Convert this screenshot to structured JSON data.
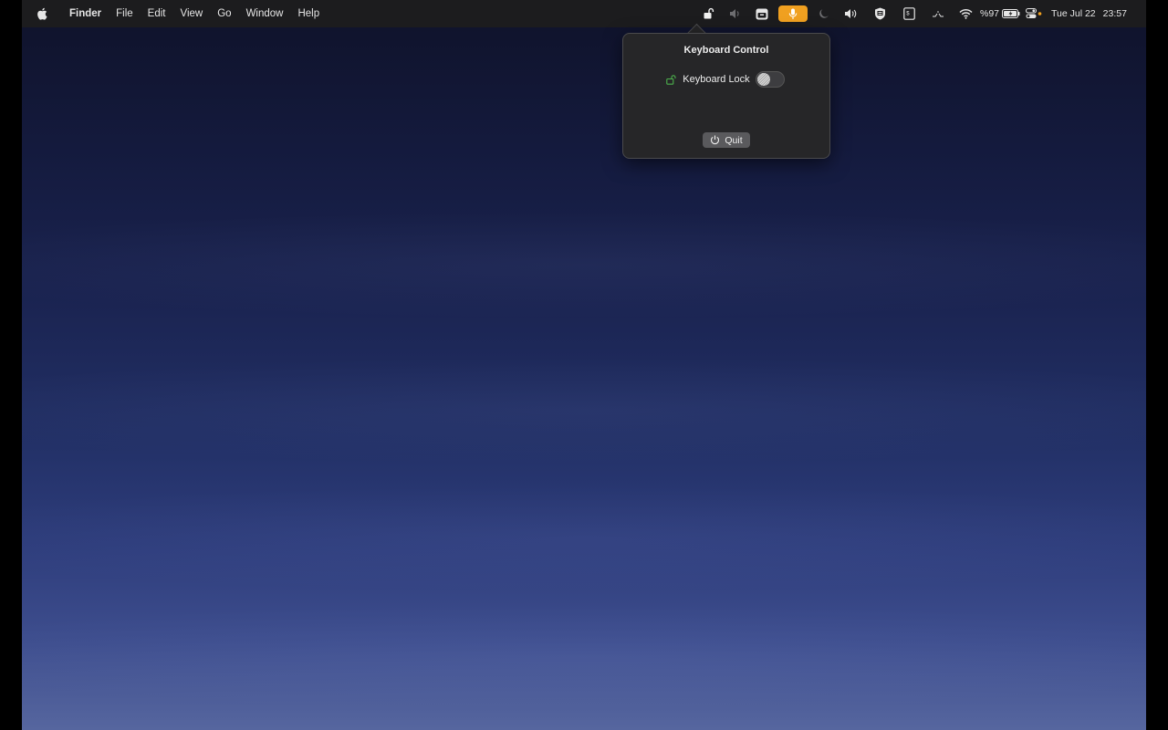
{
  "menubar": {
    "apple_icon": "apple-logo-icon",
    "app_name": "Finder",
    "menus": [
      "File",
      "Edit",
      "View",
      "Go",
      "Window",
      "Help"
    ],
    "status_icons": [
      "keyboard-lock-icon",
      "volume-muted-icon",
      "menu-app-icon",
      "microphone-icon",
      "moon-icon",
      "volume-icon",
      "shield-icon",
      "document-icon",
      "network-monitor-icon",
      "wifi-icon",
      "battery-icon",
      "control-center-icon"
    ],
    "battery_percent": "%97",
    "date": "Tue Jul 22",
    "time": "23:57",
    "accent_mic": "#f0a020"
  },
  "popup": {
    "title": "Keyboard Control",
    "lock_label": "Keyboard Lock",
    "lock_icon": "unlocked-padlock-icon",
    "lock_enabled": false,
    "quit_label": "Quit",
    "quit_icon": "power-icon"
  },
  "colors": {
    "menubar_bg": "#1c1c1e",
    "popup_bg": "#262628",
    "lock_icon_color": "#4cb04c",
    "orange_dot": "#f0a020"
  }
}
